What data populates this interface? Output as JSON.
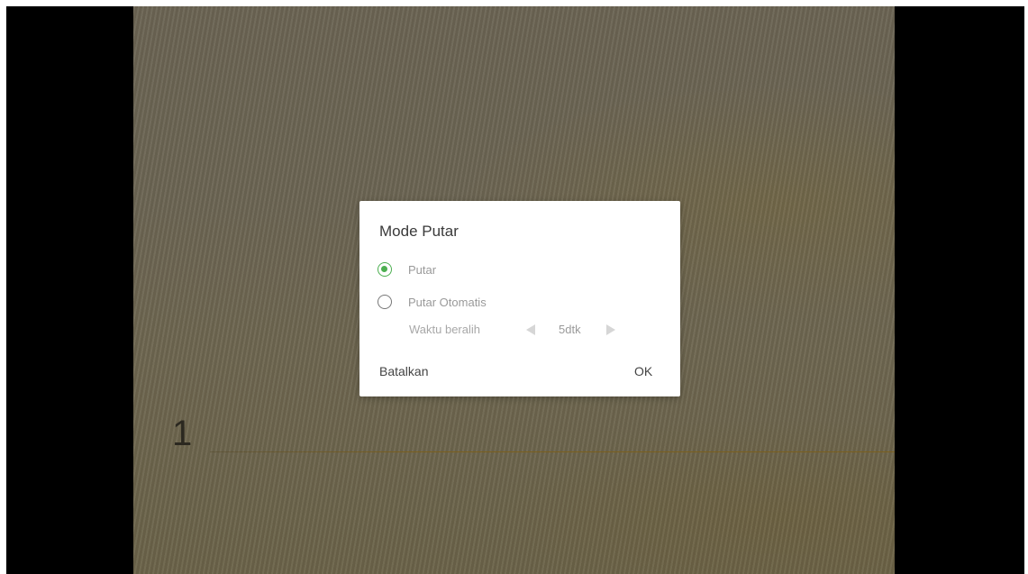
{
  "slide": {
    "number": "1"
  },
  "dialog": {
    "title": "Mode Putar",
    "options": [
      {
        "label": "Putar",
        "selected": true
      },
      {
        "label": "Putar Otomatis",
        "selected": false
      }
    ],
    "interval": {
      "label": "Waktu beralih",
      "value": "5dtk"
    },
    "cancel_label": "Batalkan",
    "ok_label": "OK"
  },
  "colors": {
    "accent": "#4caf50",
    "letterbox": "#000000",
    "dialog_bg": "#ffffff"
  }
}
